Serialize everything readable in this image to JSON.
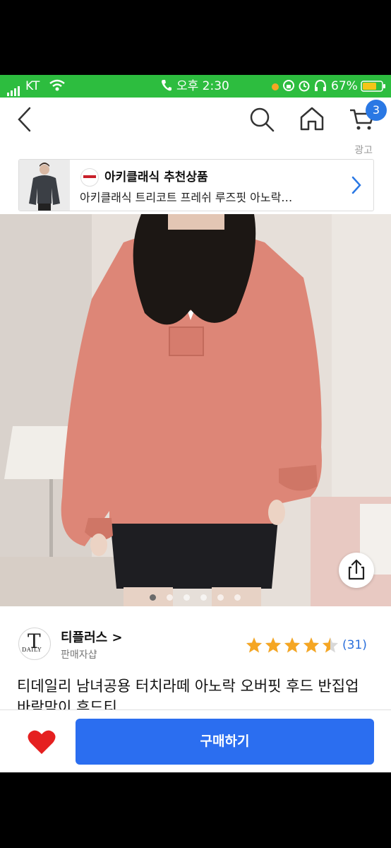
{
  "status_bar": {
    "carrier": "KT",
    "time": "오후 2:30",
    "battery": "67%"
  },
  "nav": {
    "cart_count": "3"
  },
  "ad": {
    "label": "광고",
    "title": "아키클래식 추천상품",
    "subtitle": "아키클래식 트리코트 프레쉬 루즈핏 아노락…"
  },
  "gallery": {
    "image_count": 6,
    "active_index": 0
  },
  "seller": {
    "name": "티플러스 >",
    "role": "판매자샵",
    "logo_letter": "T",
    "logo_text": "DAILY"
  },
  "rating": {
    "stars": 4.5,
    "count": "(31)"
  },
  "product": {
    "title": "티데일리 남녀공용 터치라떼 아노락 오버핏 후드 반집업 바람막이 후드티"
  },
  "bottom": {
    "buy_label": "구매하기"
  },
  "colors": {
    "status_green": "#2dbd3f",
    "accent_blue": "#2b6ef0",
    "star": "#f5a623",
    "heart": "#e52020"
  }
}
